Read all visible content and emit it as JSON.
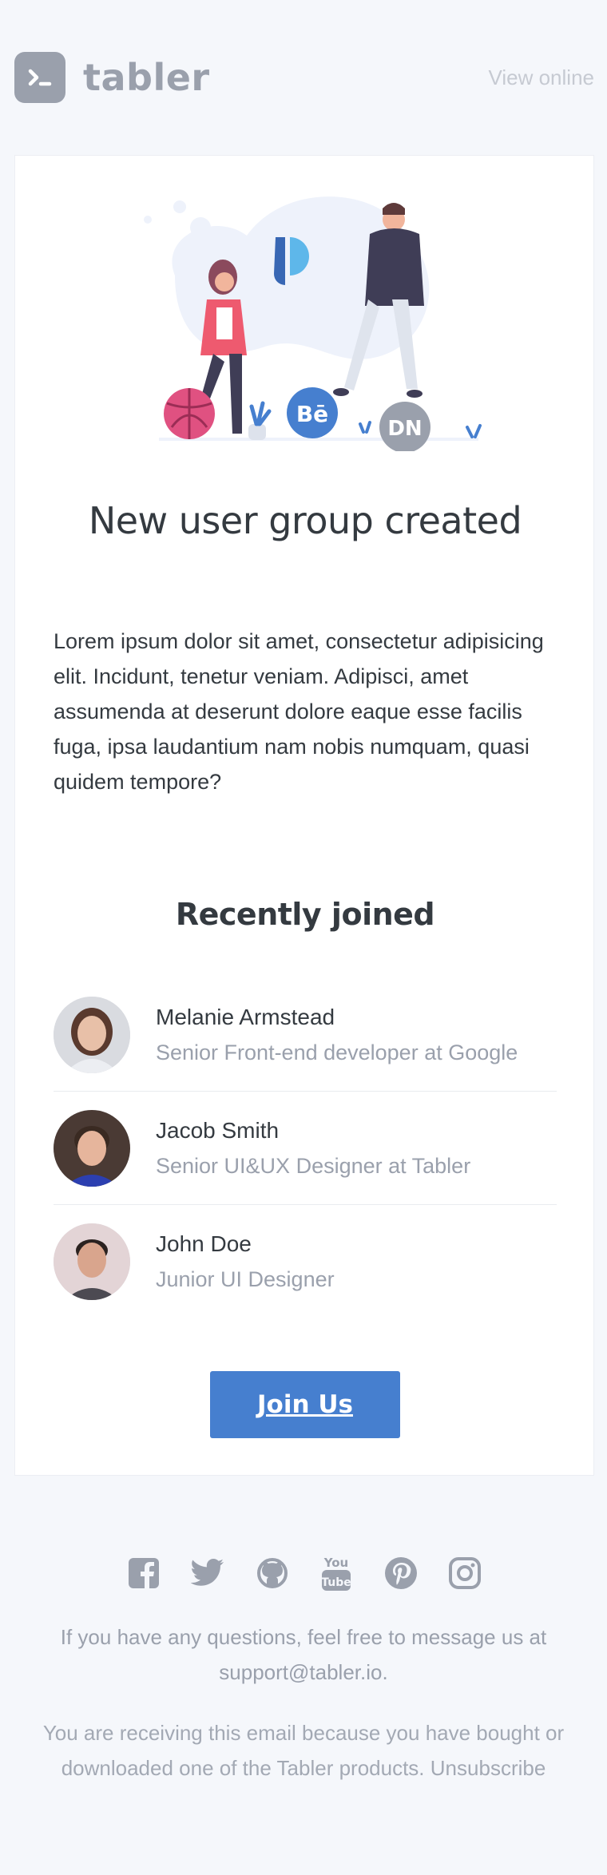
{
  "header": {
    "brand_name": "tabler",
    "view_online_label": "View online"
  },
  "illustration": {
    "badge_behance": "Bē",
    "badge_dribbble_initials": "DN"
  },
  "main": {
    "headline": "New user group created",
    "body": "Lorem ipsum dolor sit amet, consectetur adipisicing elit. Incidunt, tenetur veniam. Adipisci, amet assumenda at deserunt dolore eaque esse facilis fuga, ipsa laudantium nam nobis numquam, quasi quidem tempore?",
    "recent_title": "Recently joined",
    "members": [
      {
        "name": "Melanie Armstead",
        "role": "Senior Front-end developer at Google"
      },
      {
        "name": "Jacob Smith",
        "role": "Senior UI&UX Designer at Tabler"
      },
      {
        "name": "John Doe",
        "role": "Junior UI Designer"
      }
    ],
    "cta_label": "Join Us"
  },
  "footer": {
    "socials": [
      "facebook-icon",
      "twitter-icon",
      "github-icon",
      "youtube-icon",
      "pinterest-icon",
      "instagram-icon"
    ],
    "questions_prefix": "If you have any questions, feel free to message us at",
    "support_email": "support@tabler.io",
    "questions_suffix": ".",
    "receiving_text": "You are receiving this email because you have bought or downloaded one of the Tabler products.",
    "unsubscribe_label": "Unsubscribe"
  },
  "colors": {
    "background": "#f5f7fb",
    "brand_gray": "#9aa0ac",
    "primary": "#467fcf",
    "text": "#343a40",
    "muted": "#9aa0ac"
  }
}
